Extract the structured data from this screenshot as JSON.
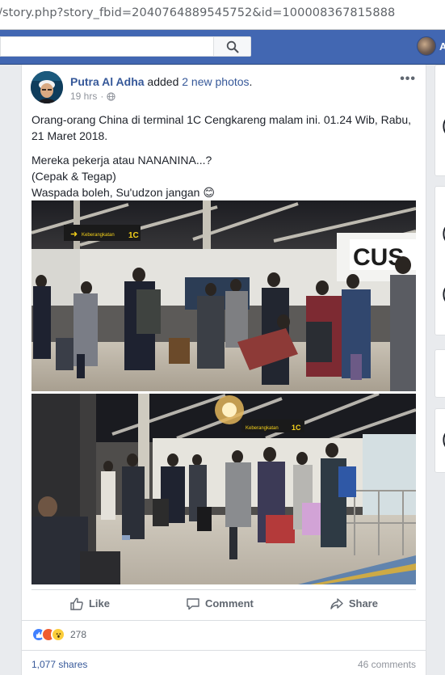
{
  "browser": {
    "url": "/story.php?story_fbid=2040764889545752&id=100008367815888"
  },
  "header": {
    "search_placeholder": "",
    "user_name_partial": "A",
    "colors": {
      "brand": "#4267b2"
    }
  },
  "post": {
    "author": "Putra Al Adha",
    "action_text": " added ",
    "photos_link": "2 new photos",
    "period": ".",
    "time": "19 hrs",
    "dot": "·",
    "privacy_icon": "globe-icon",
    "more": "•••",
    "text": {
      "p1": "Orang-orang China di terminal 1C Cengkareng malam ini. 01.24 Wib, Rabu, 21 Maret 2018.",
      "p2_line1": "Mereka pekerja atau NANANINA...?",
      "p2_line2": "(Cepak & Tegap)",
      "p2_line3": "Waspada boleh, Su'udzon jangan ",
      "emoji": "😊"
    },
    "photo_signs": {
      "photo1_sign_left": "Keberangkatan",
      "photo1_sign_term": "1C",
      "photo1_sign_right": "CUS",
      "photo2_sign_left": "Keberangkatan",
      "photo2_sign_term": "1C"
    },
    "actions": {
      "like": "Like",
      "comment": "Comment",
      "share": "Share"
    },
    "stats": {
      "reaction_icons": [
        "like-reaction-icon",
        "angry-reaction-icon",
        "wow-reaction-icon"
      ],
      "reaction_count": "278",
      "shares": "1,077 shares",
      "comments": "46 comments"
    }
  },
  "right_column": {
    "glyph1": "(",
    "glyph2": "(",
    "glyph3": "(",
    "glyph4": "("
  }
}
